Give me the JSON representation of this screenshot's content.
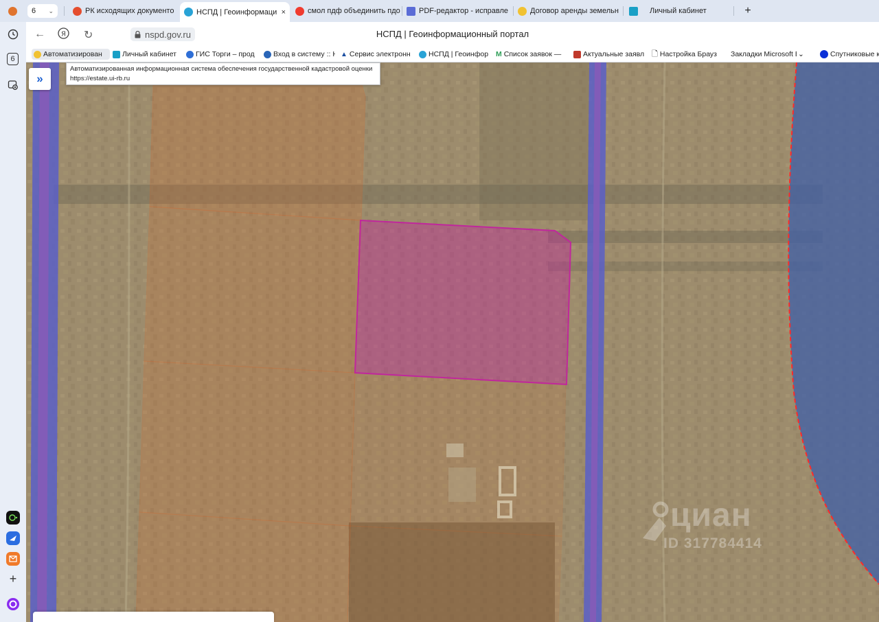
{
  "tabs": [
    {
      "label": "РК исходящих документо",
      "color": "#e54d2e"
    },
    {
      "label": "НСПД | Геоинформаци",
      "color": "#29a3d6",
      "active": true,
      "close": "×"
    },
    {
      "label": "смол пдф объединить пдо",
      "color": "#f03b2f"
    },
    {
      "label": "PDF-редактор - исправле",
      "color": "#5b6cd6"
    },
    {
      "label": "Договор аренды земельн",
      "color": "#f1c232"
    },
    {
      "label": "Личный кабинет",
      "color": "#1aa0c6"
    }
  ],
  "tab_counter": "6",
  "new_tab": "+",
  "address": {
    "url": "nspd.gov.ru",
    "title": "НСПД | Геоинформационный портал"
  },
  "bookmarks": [
    {
      "label": "Автоматизирован",
      "color": "#f1c232"
    },
    {
      "label": "Личный кабинет",
      "color": "#1aa0c6"
    },
    {
      "label": "ГИС Торги – прод",
      "color": "#2f6fd6"
    },
    {
      "label": "Вход в систему :: Н",
      "color": "#2a66b8"
    },
    {
      "label": "Сервис электронн",
      "color": "#1c4fa1"
    },
    {
      "label": "НСПД | Геоинфор",
      "color": "#29a3d6"
    },
    {
      "label": "Список заявок —",
      "color": "#2e9e57"
    },
    {
      "label": "Актуальные заявл",
      "color": "#c0392b"
    },
    {
      "label": "Настройка Брауз",
      "color": "#ffffff"
    },
    {
      "label": "Закладки Microsoft E",
      "color": "#ffffff"
    },
    {
      "label": "Спутниковые к",
      "color": "#0a2fd8"
    }
  ],
  "tooltip": {
    "title": "Автоматизированная информационная система обеспечения государственной кадастровой оценки",
    "url": "https://estate.ui-rb.ru"
  },
  "sidebar": {
    "counter": "6"
  },
  "map": {
    "expand_label": "»",
    "watermark_brand": "циан",
    "watermark_id": "ID 317784414",
    "colors": {
      "selected_parcel": "#c0279c",
      "parcel_outline": "#e0601f",
      "road": "#5a5fc8",
      "zone": "#3f5fa8",
      "zone_border": "#ff2a2a"
    }
  }
}
